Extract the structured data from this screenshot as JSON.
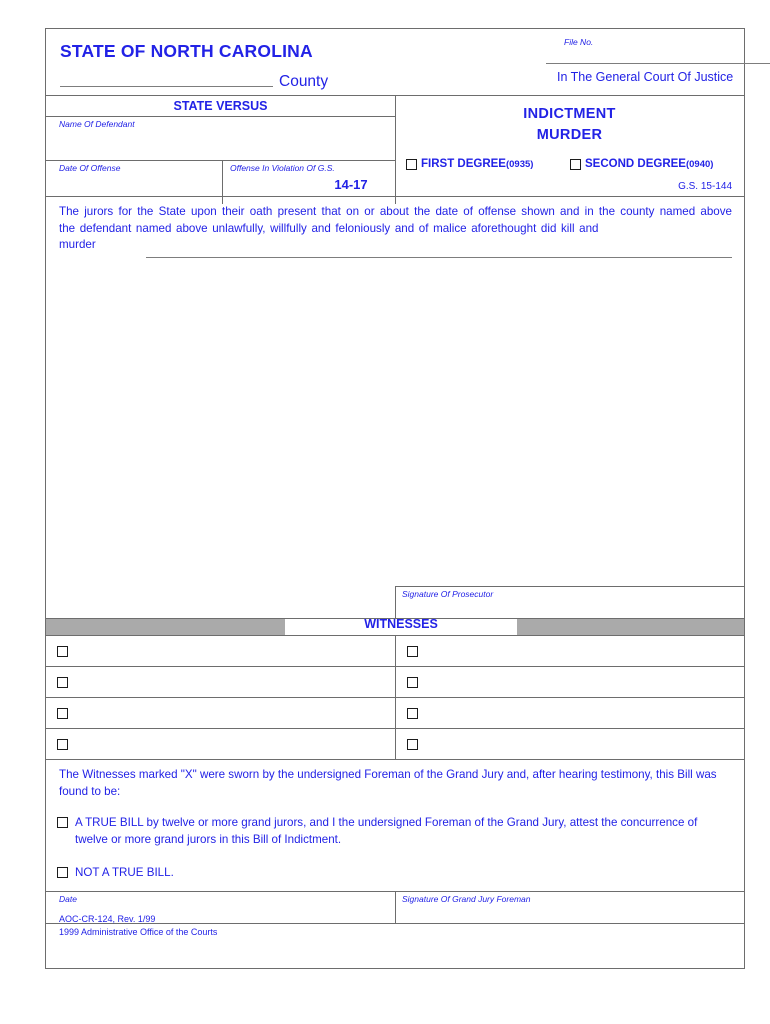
{
  "document": {
    "form_id": "AOC-CR-124",
    "header": {
      "state_title": "STATE OF NORTH CAROLINA",
      "county_label": "County",
      "file_no_label": "File No.",
      "court_label": "In The General Court Of Justice"
    },
    "left_panel": {
      "state_versus": "STATE VERSUS",
      "name_of_defendant_label": "Name Of Defendant",
      "date_of_offense_label": "Date Of Offense",
      "offense_in_violation_label": "Offense  In  Violation   Of G.S.",
      "offense_statute": "14-17"
    },
    "right_panel": {
      "title": "INDICTMENT",
      "subtitle": "MURDER",
      "degrees": [
        {
          "label": "FIRST DEGREE",
          "code": "(0935)"
        },
        {
          "label": "SECOND DEGREE",
          "code": "(0940)"
        }
      ],
      "statute_note": "G.S. 15-144"
    },
    "body": {
      "paragraph": "The jurors for the State upon their oath present that on or about the date of offense shown and in the county named above the defendant named above unlawfully,  willfully  and feloniously and of malice aforethought  did kill and",
      "last_word": "murder"
    },
    "prosecutor": {
      "signature_label": "Signature Of Prosecutor"
    },
    "witnesses": {
      "bar_label": "WITNESSES",
      "row_count": 4
    },
    "grand_jury": {
      "intro": "The Witnesses marked \"X\" were sworn by the undersigned Foreman of the Grand Jury and, after hearing testimony, this Bill was found to be:",
      "true_bill_option": "A TRUE BILL by twelve or more grand jurors, and I the undersigned Foreman of the Grand Jury, attest the concurrence of twelve or more grand jurors in this Bill of Indictment.",
      "not_true_bill_option": "NOT A TRUE BILL.",
      "date_label": "Date",
      "foreman_signature_label": "Signature Of Grand Jury Foreman"
    },
    "footer": {
      "line1": "AOC-CR-124, Rev. 1/99",
      "line2": " 1999 Administrative Office of the Courts"
    },
    "colors": {
      "ink_blue": "#2222e6",
      "rule_gray": "#6d6d6d",
      "bar_gray": "#aaaaaa"
    }
  }
}
